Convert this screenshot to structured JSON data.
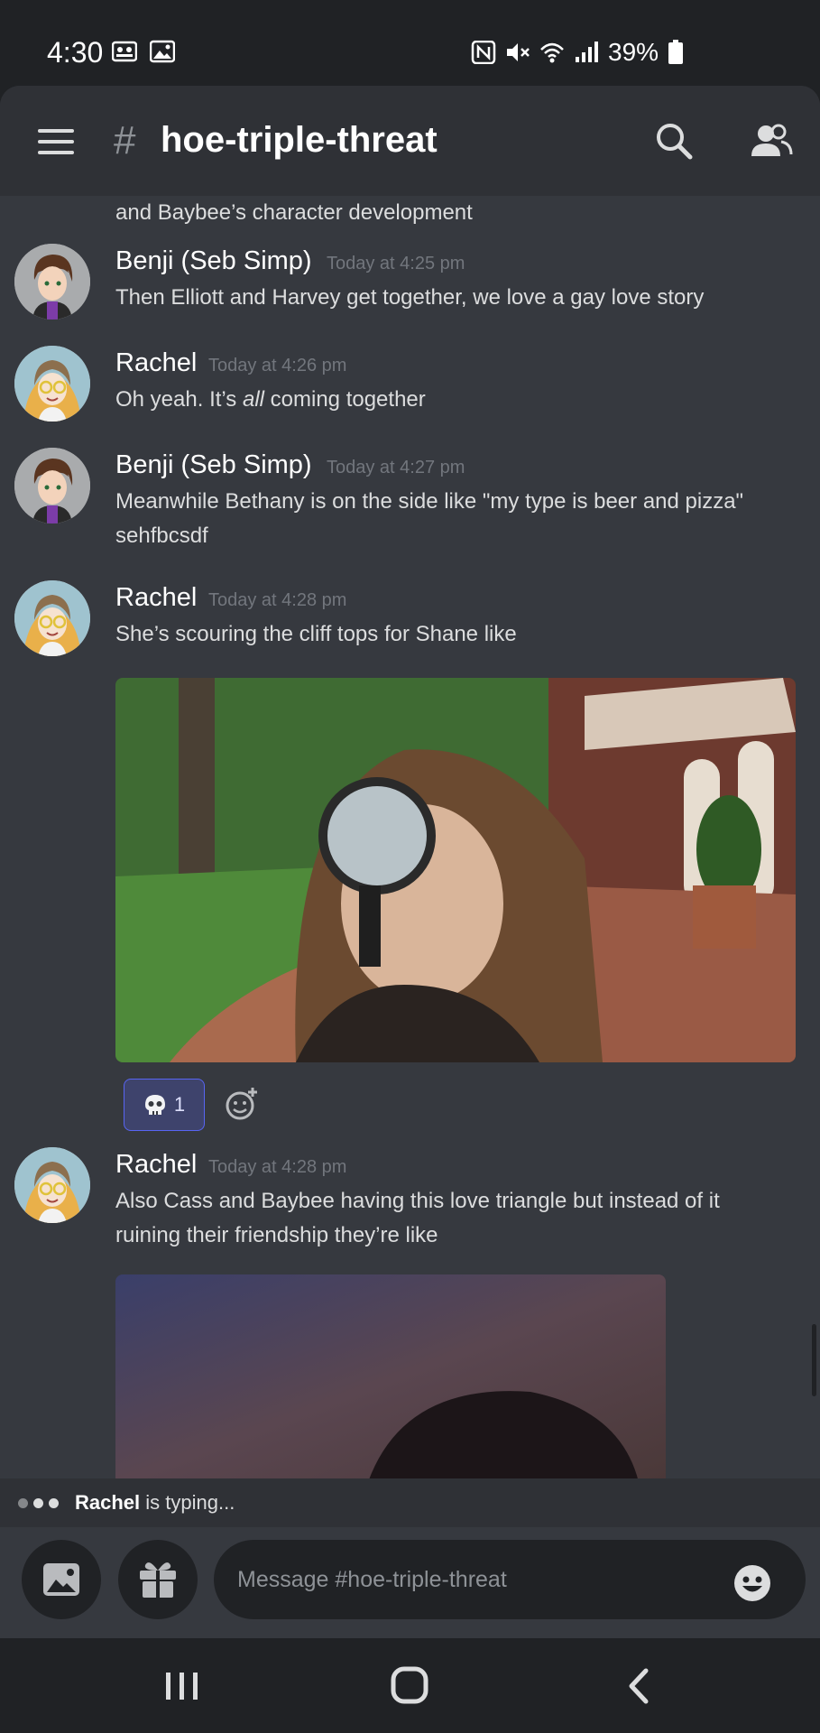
{
  "status_bar": {
    "time": "4:30",
    "battery": "39%"
  },
  "header": {
    "channel_name": "hoe-triple-threat",
    "icons": [
      "menu-icon",
      "hash-icon",
      "search-icon",
      "members-icon"
    ]
  },
  "messages": [
    {
      "text": "and Baybee’s character development"
    },
    {
      "author": "Benji (Seb Simp)",
      "timestamp": "Today at 4:25 pm",
      "text": "Then Elliott and Harvey get together, we love a gay love story"
    },
    {
      "author": "Rachel",
      "timestamp": "Today at 4:26 pm",
      "text_before": "Oh yeah. It’s ",
      "text_em": "all",
      "text_after": " coming together"
    },
    {
      "author": "Benji (Seb Simp)",
      "timestamp": "Today at 4:27 pm",
      "text": "Meanwhile Bethany is on the side like \"my type is beer and pizza\"",
      "text2": "sehfbcsdf"
    },
    {
      "author": "Rachel",
      "timestamp": "Today at 4:28 pm",
      "text": "She’s scouring the cliff tops for Shane like"
    },
    {
      "author": "Rachel",
      "timestamp": "Today at 4:28 pm",
      "text": "Also Cass and Baybee having this love triangle but instead of it",
      "text2": "ruining their friendship they’re like"
    }
  ],
  "reaction": {
    "emoji": "skull-icon",
    "count": "1"
  },
  "typing": {
    "name": "Rachel",
    "suffix": " is typing..."
  },
  "composer": {
    "placeholder": "Message #hoe-triple-threat",
    "icons": [
      "image-icon",
      "gift-icon",
      "emoji-icon"
    ]
  },
  "colors": {
    "background": "#36393f",
    "header": "#2f3136",
    "accent": "#5865f2",
    "author_rachel": "#ffffff",
    "muted": "#72767d"
  }
}
